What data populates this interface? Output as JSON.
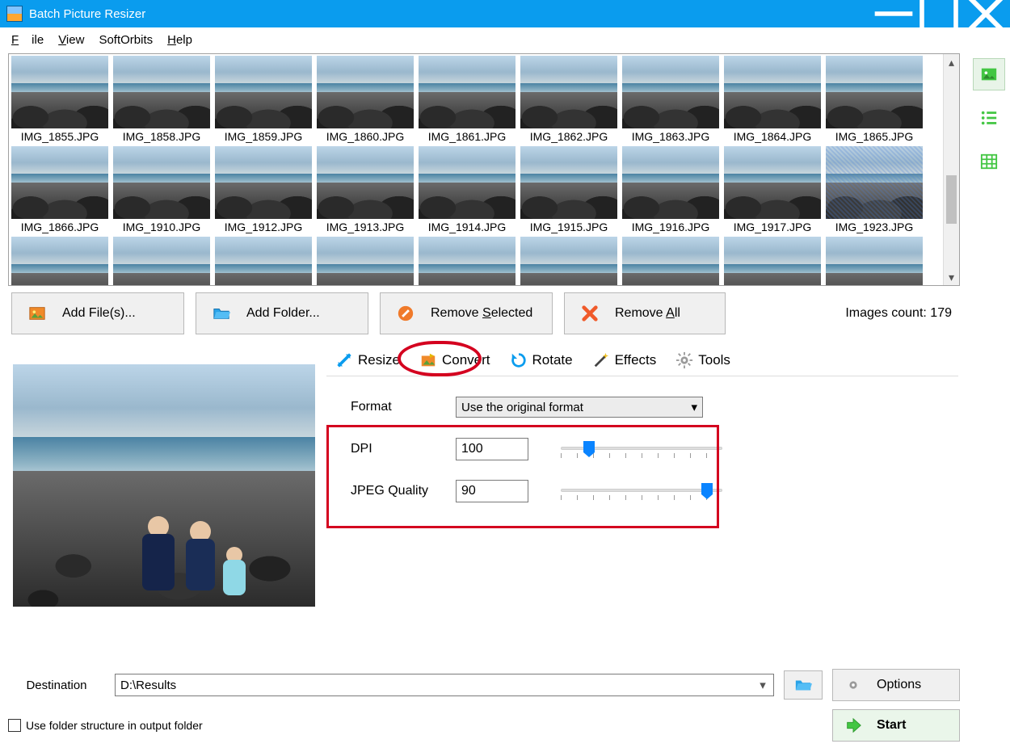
{
  "window": {
    "title": "Batch Picture Resizer"
  },
  "menu": {
    "file": "File",
    "view": "View",
    "softorbits": "SoftOrbits",
    "help": "Help"
  },
  "thumbnails": {
    "items": [
      {
        "label": "IMG_1855.JPG"
      },
      {
        "label": "IMG_1858.JPG"
      },
      {
        "label": "IMG_1859.JPG"
      },
      {
        "label": "IMG_1860.JPG"
      },
      {
        "label": "IMG_1861.JPG"
      },
      {
        "label": "IMG_1862.JPG"
      },
      {
        "label": "IMG_1863.JPG"
      },
      {
        "label": "IMG_1864.JPG"
      },
      {
        "label": "IMG_1865.JPG"
      },
      {
        "label": "IMG_1866.JPG"
      },
      {
        "label": "IMG_1910.JPG"
      },
      {
        "label": "IMG_1912.JPG"
      },
      {
        "label": "IMG_1913.JPG"
      },
      {
        "label": "IMG_1914.JPG"
      },
      {
        "label": "IMG_1915.JPG"
      },
      {
        "label": "IMG_1916.JPG"
      },
      {
        "label": "IMG_1917.JPG"
      },
      {
        "label": "IMG_1923.JPG",
        "selected": true
      }
    ]
  },
  "actions": {
    "add_files": "Add File(s)...",
    "add_folder": "Add Folder...",
    "remove_selected": "Remove Selected",
    "remove_all": "Remove All"
  },
  "count_label_prefix": "Images count: ",
  "count_value": "179",
  "tabs": {
    "resize": "Resize",
    "convert": "Convert",
    "rotate": "Rotate",
    "effects": "Effects",
    "tools": "Tools"
  },
  "convert_panel": {
    "format_label": "Format",
    "format_value": "Use the original format",
    "dpi_label": "DPI",
    "dpi_value": "100",
    "jpeg_label": "JPEG Quality",
    "jpeg_value": "90"
  },
  "destination": {
    "label": "Destination",
    "value": "D:\\Results",
    "use_folder_structure": "Use folder structure in output folder"
  },
  "buttons": {
    "options": "Options",
    "start": "Start"
  },
  "colors": {
    "accent_blue": "#0a9cee",
    "highlight_red": "#d4001f",
    "start_green": "#43c643"
  }
}
